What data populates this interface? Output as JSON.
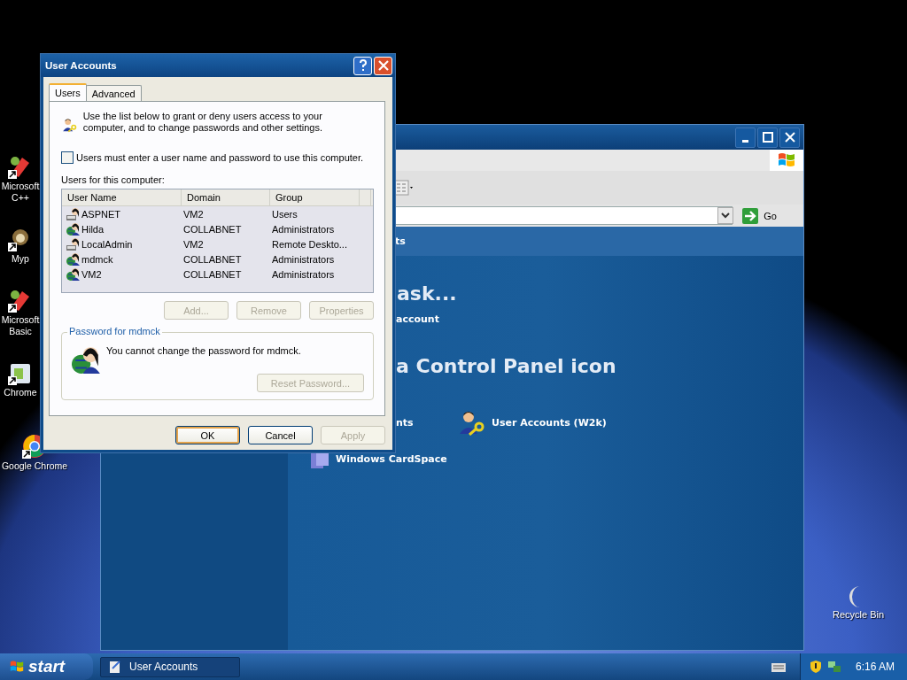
{
  "desktop": {
    "icons": [
      {
        "label": "Microsoft C++",
        "kind": "app"
      },
      {
        "label": "Myp",
        "kind": "folder"
      },
      {
        "label": "Microsoft Basic",
        "kind": "app"
      },
      {
        "label": "Chrome",
        "kind": "installer"
      },
      {
        "label": "Google Chrome",
        "kind": "chrome"
      }
    ],
    "recycle_bin": {
      "label": "Recycle Bin"
    }
  },
  "control_panel_window": {
    "go_label": "Go",
    "header_text": "ts",
    "heading_task": "ask...",
    "task_link": "account",
    "heading_icon": "a Control Panel icon",
    "items": [
      {
        "label": "nts",
        "kind": "cut"
      },
      {
        "label": "User Accounts (W2k)",
        "kind": "users"
      },
      {
        "label": "Windows CardSpace",
        "kind": "cardspace"
      }
    ]
  },
  "dialog": {
    "title": "User Accounts",
    "tabs": [
      {
        "label": "Users",
        "selected": true
      },
      {
        "label": "Advanced",
        "selected": false
      }
    ],
    "intro": "Use the list below to grant or deny users access to your computer, and to change passwords and other settings.",
    "checkbox": {
      "label": "Users must enter a user name and password to use this computer.",
      "checked": false
    },
    "list_label": "Users for this computer:",
    "columns": [
      "User Name",
      "Domain",
      "Group"
    ],
    "rows": [
      {
        "user_name": "ASPNET",
        "domain": "VM2",
        "group": "Users",
        "kind": "local",
        "selected": false
      },
      {
        "user_name": "Hilda",
        "domain": "COLLABNET",
        "group": "Administrators",
        "kind": "domain",
        "selected": false
      },
      {
        "user_name": "LocalAdmin",
        "domain": "VM2",
        "group": "Remote Deskto...",
        "kind": "local",
        "selected": false
      },
      {
        "user_name": "mdmck",
        "domain": "COLLABNET",
        "group": "Administrators",
        "kind": "domain",
        "selected": false
      },
      {
        "user_name": "VM2",
        "domain": "COLLABNET",
        "group": "Administrators",
        "kind": "domain",
        "selected": false
      }
    ],
    "list_buttons": [
      {
        "label": "Add...",
        "disabled": true
      },
      {
        "label": "Remove",
        "disabled": true
      },
      {
        "label": "Properties",
        "disabled": true
      }
    ],
    "password_group": {
      "title": "Password for mdmck",
      "message": "You cannot change the password for mdmck.",
      "button": {
        "label": "Reset Password...",
        "disabled": true
      }
    },
    "footer_buttons": [
      {
        "label": "OK",
        "disabled": false,
        "default": true
      },
      {
        "label": "Cancel",
        "disabled": false,
        "default": false
      },
      {
        "label": "Apply",
        "disabled": true,
        "default": false
      }
    ]
  },
  "taskbar": {
    "start_label": "start",
    "tasks": [
      {
        "label": "User Accounts",
        "selected": true
      }
    ],
    "clock": "6:16 AM"
  }
}
